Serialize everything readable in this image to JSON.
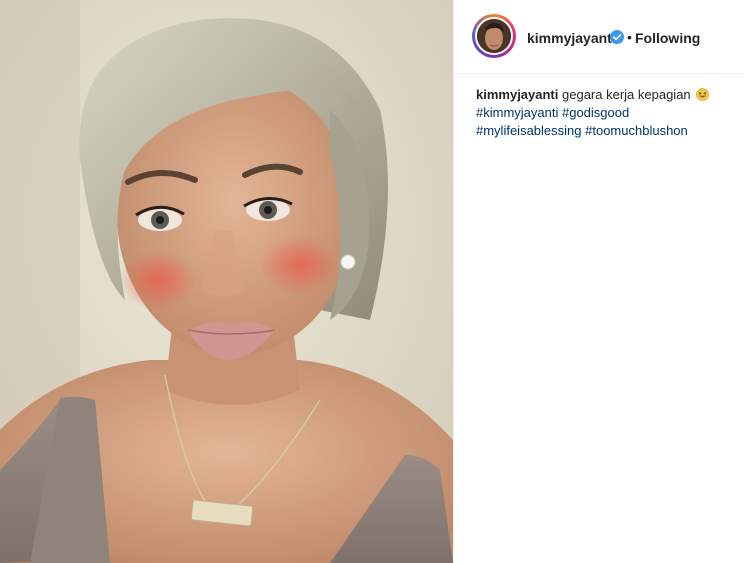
{
  "post": {
    "username": "kimmyjayanti",
    "verified_icon": "verified-badge-icon",
    "separator": "•",
    "follow_label": "Following",
    "caption": {
      "username": "kimmyjayanti",
      "text": "gegara kerja kepagian",
      "emoji": "grinning-squinting-face-emoji",
      "hashtags": [
        "#kimmyjayanti",
        "#godisgood",
        "#mylifeisablessing",
        "#toomuchblushon"
      ]
    }
  },
  "colors": {
    "text": "#262626",
    "hashtag": "#003569",
    "verified": "#3897f0",
    "divider": "#efefef"
  }
}
